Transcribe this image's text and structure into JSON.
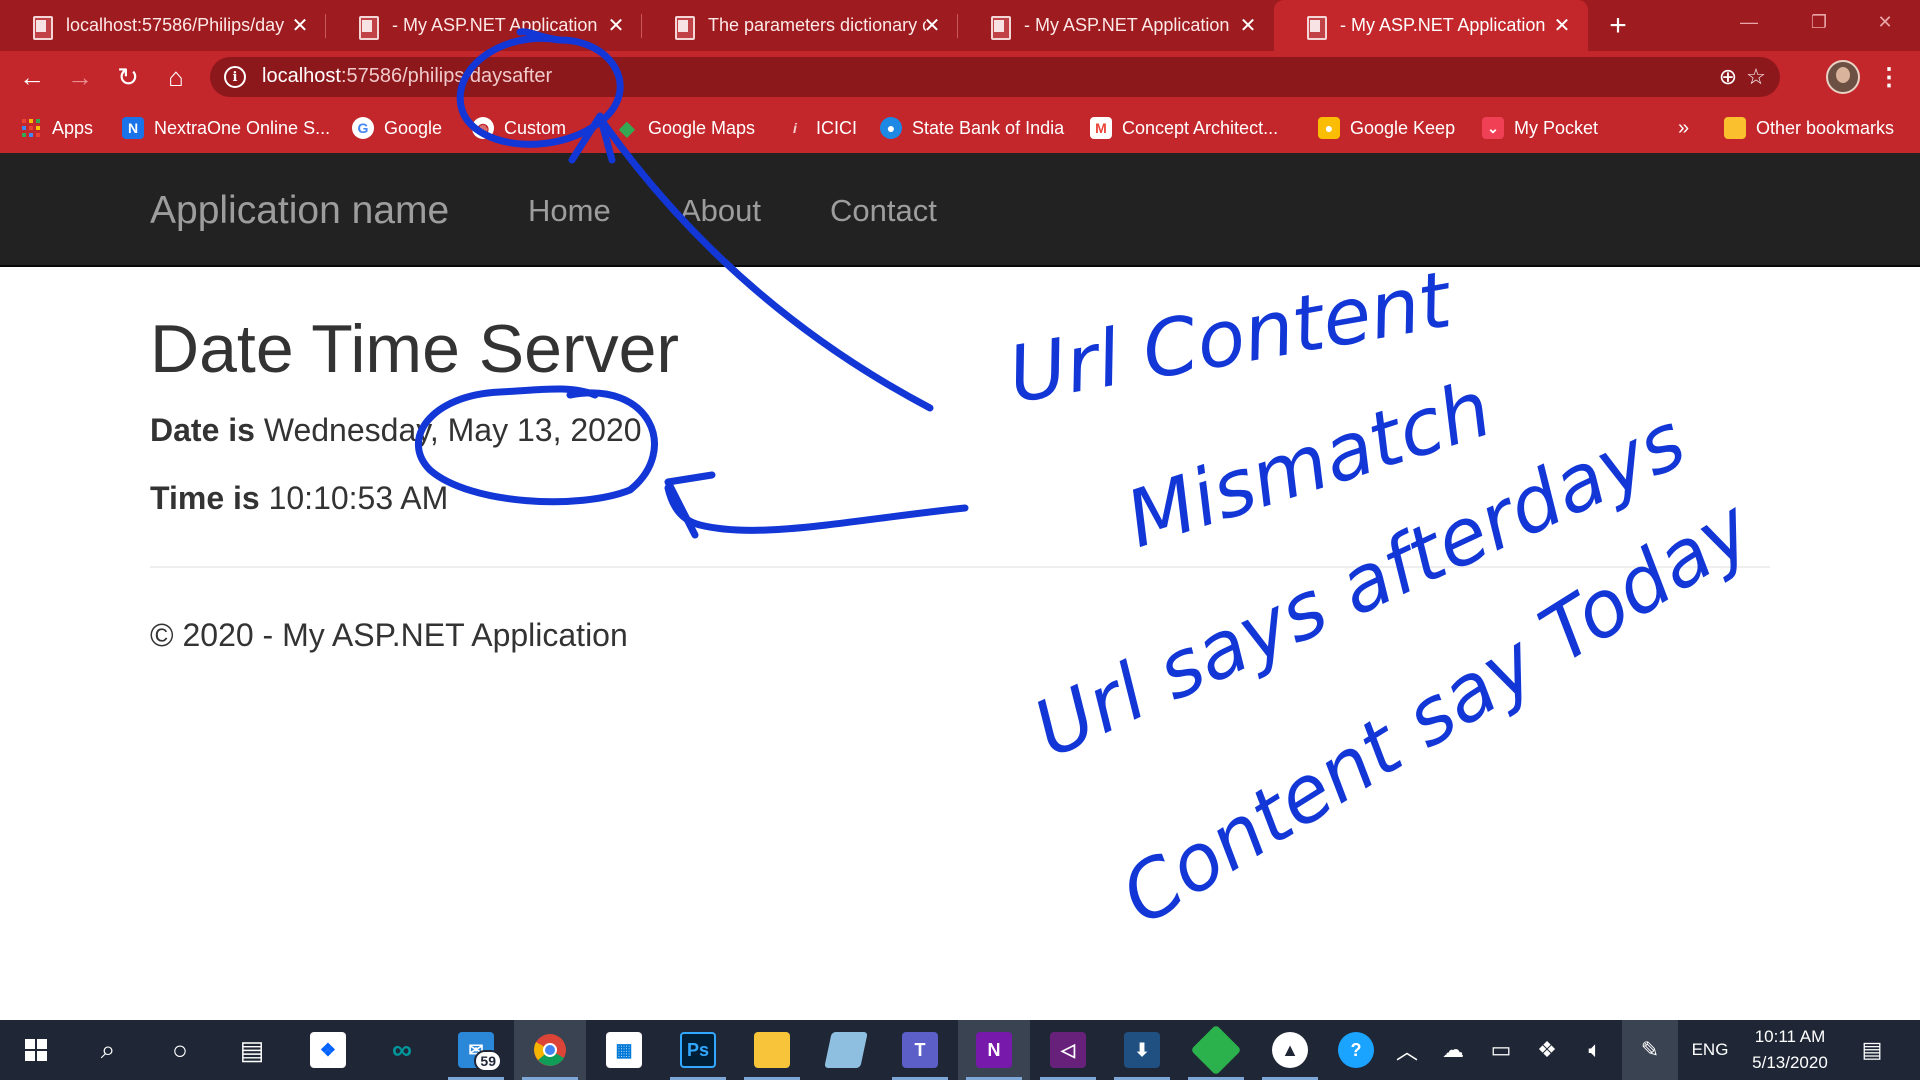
{
  "browser": {
    "tabs": [
      {
        "title": "localhost:57586/Philips/day",
        "active": false
      },
      {
        "title": "- My ASP.NET Application",
        "active": false
      },
      {
        "title": "The parameters dictionary c",
        "active": false
      },
      {
        "title": "- My ASP.NET Application",
        "active": false
      },
      {
        "title": "- My ASP.NET Application",
        "active": true
      }
    ],
    "new_tab_label": "+",
    "url_host": "localhost",
    "url_rest": ":57586/philips/daysafter",
    "bookmarks": [
      {
        "label": "Apps",
        "icon": "apps-grid-icon",
        "color": "#e94235"
      },
      {
        "label": "NextraOne Online S...",
        "icon": "nextraone-icon",
        "color": "#1a73e8"
      },
      {
        "label": "Google",
        "icon": "google-icon",
        "color": "#ffffff"
      },
      {
        "label": "Custom",
        "icon": "globe-icon",
        "color": "#ffffff"
      },
      {
        "label": "Google Maps",
        "icon": "maps-pin-icon",
        "color": "#34a853"
      },
      {
        "label": "ICICI",
        "icon": "icici-icon",
        "color": "#f7b8b8"
      },
      {
        "label": "State Bank of India",
        "icon": "sbi-icon",
        "color": "#1e88e5"
      },
      {
        "label": "Concept Architect...",
        "icon": "gmail-icon",
        "color": "#ffffff"
      },
      {
        "label": "Google Keep",
        "icon": "keep-icon",
        "color": "#fbbc04"
      },
      {
        "label": "My Pocket",
        "icon": "pocket-icon",
        "color": "#ef4056"
      }
    ],
    "bookmarks_overflow": "»",
    "other_bookmarks": "Other bookmarks"
  },
  "page": {
    "brand": "Application name",
    "nav": [
      "Home",
      "About",
      "Contact"
    ],
    "title": "Date Time Server",
    "date_label": "Date is",
    "date_value": "Wednesday, May 13, 2020",
    "time_label": "Time is",
    "time_value": "10:10:53 AM",
    "footer": "© 2020 - My ASP.NET Application"
  },
  "annotation": {
    "color": "#1237d6",
    "lines": [
      "Url Content",
      "Mismatch",
      "Url says afterdays",
      "Content say Today"
    ]
  },
  "taskbar": {
    "mail_badge": "59",
    "language": "ENG",
    "time": "10:11 AM",
    "date": "5/13/2020"
  }
}
